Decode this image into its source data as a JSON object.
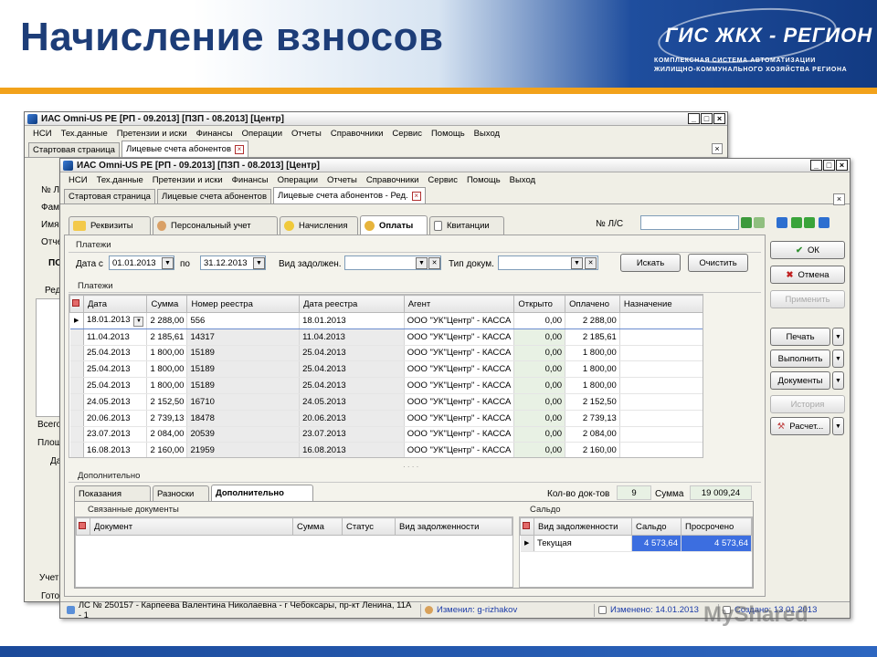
{
  "slide": {
    "title": "Начисление взносов",
    "logo_main": "ГИС ЖКХ - РЕГИОН",
    "logo_sub1": "КОМПЛЕКСНАЯ СИСТЕМА АВТОМАТИЗАЦИИ",
    "logo_sub2": "ЖИЛИЩНО-КОММУНАЛЬНОГО ХОЗЯЙСТВА РЕГИОНА"
  },
  "back_window": {
    "title": "ИАС Omni-US PE [РП - 09.2013] [ПЗП - 08.2013] [Центр]",
    "menu": [
      "НСИ",
      "Тех.данные",
      "Претензии и иски",
      "Финансы",
      "Операции",
      "Отчеты",
      "Справочники",
      "Сервис",
      "Помощь",
      "Выход"
    ],
    "tabs": [
      "Стартовая страница",
      "Лицевые счета абонентов"
    ],
    "side_labels": [
      "№ Л/",
      "Фами",
      "Имя",
      "Отче",
      "По",
      "Ред",
      "Всего",
      "Площ",
      "Да",
      "Учет",
      "Готов"
    ],
    "side_label_po": "ПО"
  },
  "window": {
    "title": "ИАС Omni-US PE [РП - 09.2013] [ПЗП - 08.2013] [Центр]",
    "menu": [
      "НСИ",
      "Тех.данные",
      "Претензии и иски",
      "Финансы",
      "Операции",
      "Отчеты",
      "Справочники",
      "Сервис",
      "Помощь",
      "Выход"
    ],
    "tabs": [
      "Стартовая страница",
      "Лицевые счета абонентов",
      "Лицевые счета абонентов - Ред."
    ],
    "subtabs": [
      "Реквизиты",
      "Персональный учет",
      "Начисления",
      "Оплаты",
      "Квитанции"
    ],
    "account_label": "№ Л/С",
    "account_value": ""
  },
  "filter": {
    "group_title": "Платежи",
    "date_from_label": "Дата с",
    "date_from": "01.01.2013",
    "to_label": "по",
    "date_to": "31.12.2013",
    "debt_type_label": "Вид задолжен.",
    "debt_type": "",
    "doc_type_label": "Тип докум.",
    "doc_type": "",
    "search_button": "Искать",
    "clear_button": "Очистить"
  },
  "payments": {
    "group_title": "Платежи",
    "columns": [
      "Дата",
      "Сумма",
      "Номер реестра",
      "Дата реестра",
      "Агент",
      "Открыто",
      "Оплачено",
      "Назначение"
    ],
    "rows": [
      [
        "18.01.2013",
        "2 288,00",
        "556",
        "18.01.2013",
        "ООО \"УК\"Центр\" - КАССА",
        "0,00",
        "2 288,00",
        ""
      ],
      [
        "11.04.2013",
        "2 185,61",
        "14317",
        "11.04.2013",
        "ООО \"УК\"Центр\" - КАССА",
        "0,00",
        "2 185,61",
        ""
      ],
      [
        "25.04.2013",
        "1 800,00",
        "15189",
        "25.04.2013",
        "ООО \"УК\"Центр\" - КАССА",
        "0,00",
        "1 800,00",
        ""
      ],
      [
        "25.04.2013",
        "1 800,00",
        "15189",
        "25.04.2013",
        "ООО \"УК\"Центр\" - КАССА",
        "0,00",
        "1 800,00",
        ""
      ],
      [
        "25.04.2013",
        "1 800,00",
        "15189",
        "25.04.2013",
        "ООО \"УК\"Центр\" - КАССА",
        "0,00",
        "1 800,00",
        ""
      ],
      [
        "24.05.2013",
        "2 152,50",
        "16710",
        "24.05.2013",
        "ООО \"УК\"Центр\" - КАССА",
        "0,00",
        "2 152,50",
        ""
      ],
      [
        "20.06.2013",
        "2 739,13",
        "18478",
        "20.06.2013",
        "ООО \"УК\"Центр\" - КАССА",
        "0,00",
        "2 739,13",
        ""
      ],
      [
        "23.07.2013",
        "2 084,00",
        "20539",
        "23.07.2013",
        "ООО \"УК\"Центр\" - КАССА",
        "0,00",
        "2 084,00",
        ""
      ],
      [
        "16.08.2013",
        "2 160,00",
        "21959",
        "16.08.2013",
        "ООО \"УК\"Центр\" - КАССА",
        "0,00",
        "2 160,00",
        ""
      ]
    ]
  },
  "additional": {
    "group_title": "Дополнительно",
    "tabs": [
      "Показания",
      "Разноски",
      "Дополнительно"
    ],
    "doc_count_label": "Кол-во док-тов",
    "doc_count": "9",
    "sum_label": "Сумма",
    "sum": "19 009,24",
    "linked_title": "Связанные документы",
    "linked_columns": [
      "Документ",
      "Сумма",
      "Статус",
      "Вид задолженности"
    ],
    "saldo_title": "Сальдо",
    "saldo_columns": [
      "Вид задолженности",
      "Сальдо",
      "Просрочено"
    ],
    "saldo_rows": [
      [
        "Текущая",
        "4 573,64",
        "4 573,64"
      ]
    ]
  },
  "actions": {
    "ok": "ОК",
    "cancel": "Отмена",
    "apply": "Применить",
    "print": "Печать",
    "execute": "Выполнить",
    "documents": "Документы",
    "history": "История",
    "calc": "Расчет..."
  },
  "status": {
    "account": "ЛС № 250157 - Карпеева Валентина Николаевна - г Чебоксары, пр-кт Ленина, 11А - 1",
    "changed_by": "Изменил: g-rizhakov",
    "changed": "Изменено: 14.01.2013",
    "created": "Создано: 13.01.2013"
  },
  "watermark": "MyShared",
  "colors": {
    "accent_orange": "#f2a21b",
    "header_blue": "#1d3d78",
    "selection_blue": "#3c6ee0"
  }
}
